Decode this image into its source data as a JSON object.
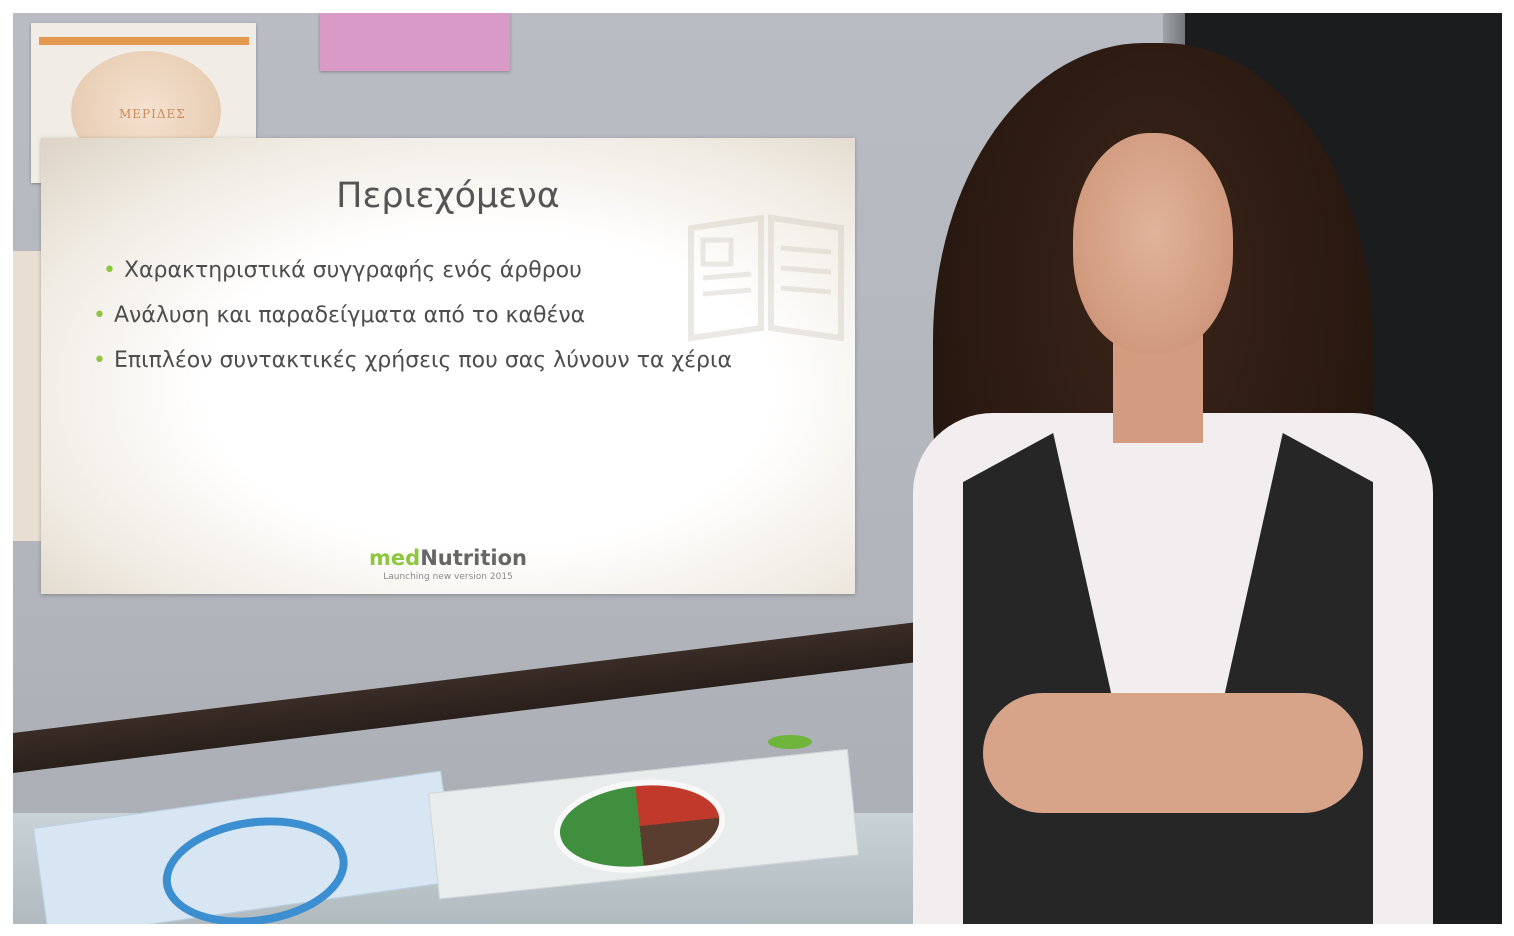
{
  "slide": {
    "title": "Περιεχόμενα",
    "bullets": [
      "Χαρακτηριστικά συγγραφής ενός άρθρου",
      "Ανάλυση και παραδείγματα από το καθένα",
      "Επιπλέον συντακτικές χρήσεις που σας λύνουν τα χέρια"
    ],
    "bullet_marker": "•",
    "brand_med": "med",
    "brand_nutrition": "Nutrition",
    "brand_tagline": "Launching new version 2015"
  },
  "poster": {
    "label": "ΜΕΡΙΔΕΣ"
  },
  "colors": {
    "brand_green": "#8dc63f",
    "slide_text": "#4d4d4d",
    "dark_wall": "#1b1c1e"
  }
}
